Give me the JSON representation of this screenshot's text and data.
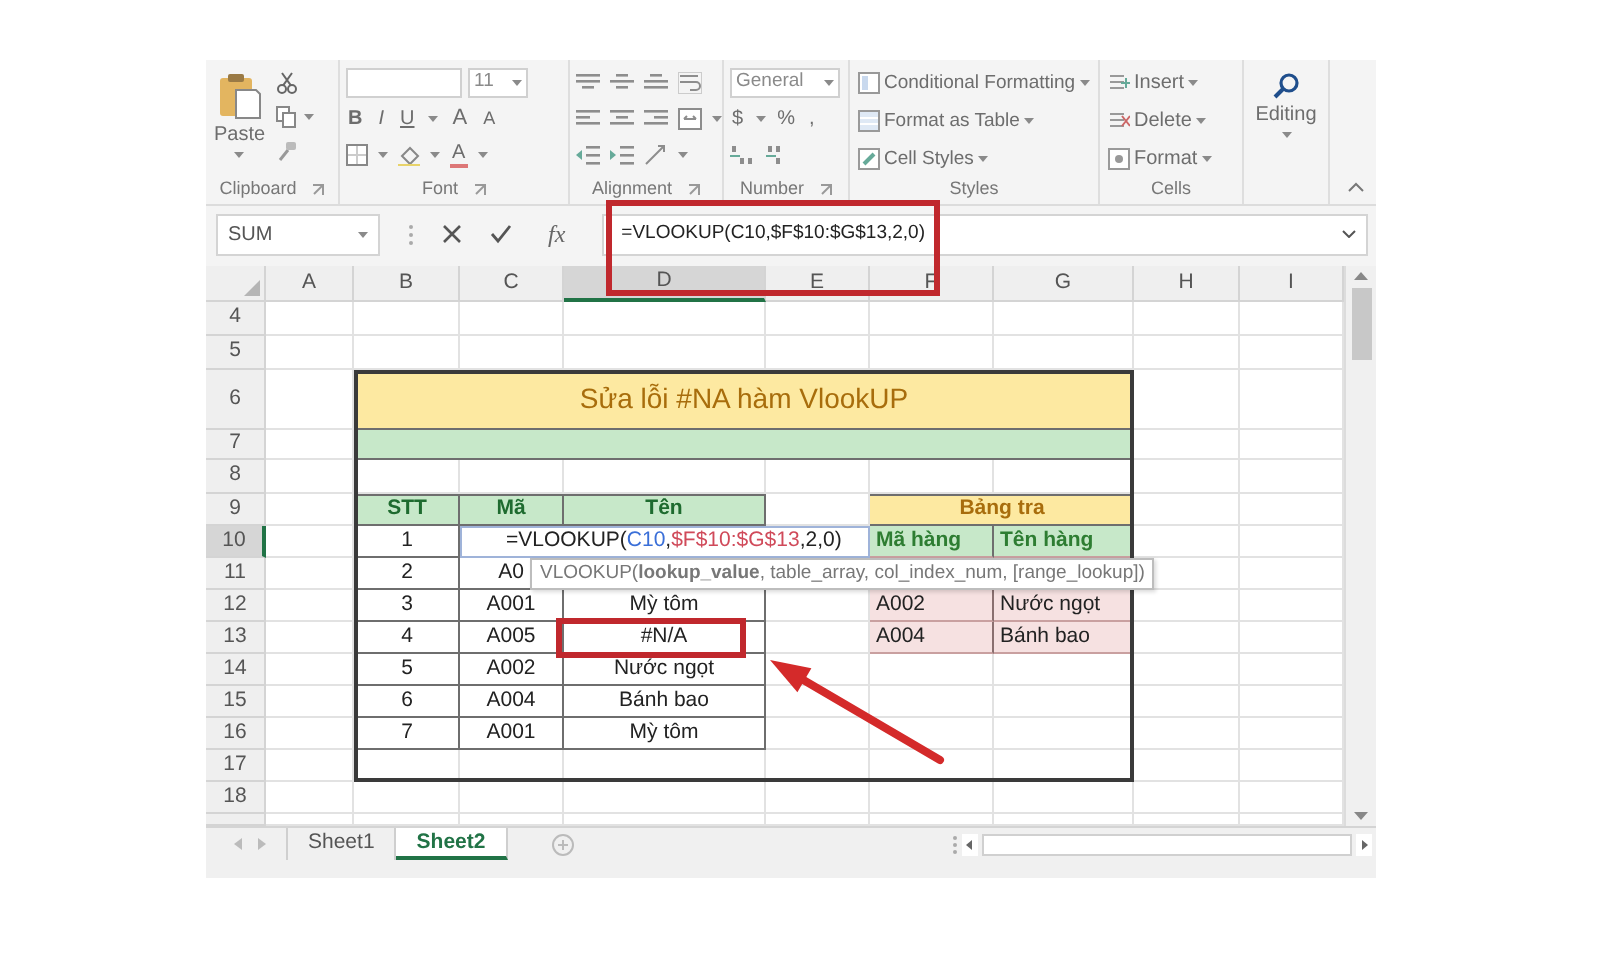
{
  "ribbon": {
    "groups": [
      {
        "kind": "clipboard",
        "label": "Clipboard",
        "paste": "Paste"
      },
      {
        "kind": "font",
        "label": "Font",
        "size": "11",
        "styles": [
          "B",
          "I",
          "U"
        ],
        "grow": "A",
        "shrink": "A",
        "font_color_label": "A"
      },
      {
        "kind": "alignment",
        "label": "Alignment"
      },
      {
        "kind": "number",
        "label": "Number",
        "format": "General",
        "symbols": [
          "$",
          "%",
          ","
        ]
      },
      {
        "kind": "styles",
        "label": "Styles",
        "commands": [
          "Conditional Formatting",
          "Format as Table",
          "Cell Styles"
        ]
      },
      {
        "kind": "cells",
        "label": "Cells",
        "commands": [
          "Insert",
          "Delete",
          "Format"
        ]
      },
      {
        "kind": "editing",
        "command": "Editing"
      }
    ]
  },
  "formula_bar": {
    "name_box": "SUM",
    "function_label": "fx",
    "formula": "=VLOOKUP(C10,$F$10:$G$13,2,0)",
    "flagged": true
  },
  "grid": {
    "columns": [
      {
        "label": "A",
        "selected": false
      },
      {
        "label": "B",
        "selected": false
      },
      {
        "label": "C",
        "selected": false
      },
      {
        "label": "D",
        "selected": true
      },
      {
        "label": "E",
        "selected": false
      },
      {
        "label": "F",
        "selected": false
      },
      {
        "label": "G",
        "selected": false
      },
      {
        "label": "H",
        "selected": false
      },
      {
        "label": "I",
        "selected": false
      }
    ],
    "rows": [
      {
        "label": "4",
        "selected": false
      },
      {
        "label": "5",
        "selected": false
      },
      {
        "label": "6",
        "selected": false
      },
      {
        "label": "7",
        "selected": false
      },
      {
        "label": "8",
        "selected": false
      },
      {
        "label": "9",
        "selected": false
      },
      {
        "label": "10",
        "selected": true
      },
      {
        "label": "11",
        "selected": false
      },
      {
        "label": "12",
        "selected": false
      },
      {
        "label": "13",
        "selected": false
      },
      {
        "label": "14",
        "selected": false
      },
      {
        "label": "15",
        "selected": false
      },
      {
        "label": "16",
        "selected": false
      },
      {
        "label": "17",
        "selected": false
      },
      {
        "label": "18",
        "selected": false
      }
    ]
  },
  "main_table": {
    "title": "Sửa lỗi #NA hàm VlookUP",
    "headers": [
      "STT",
      "Mã",
      "Tên"
    ],
    "rows": [
      {
        "cells": [
          "1"
        ],
        "flagged": false
      },
      {
        "cells": [
          "2",
          "A0"
        ],
        "flagged": false
      },
      {
        "cells": [
          "3",
          "A001",
          "Mỳ tôm"
        ],
        "flagged": false
      },
      {
        "cells": [
          "4",
          "A005",
          "#N/A"
        ],
        "flagged": true
      },
      {
        "cells": [
          "5",
          "A002",
          "Nước ngọt"
        ],
        "flagged": false
      },
      {
        "cells": [
          "6",
          "A004",
          "Bánh bao"
        ],
        "flagged": false
      },
      {
        "cells": [
          "7",
          "A001",
          "Mỳ tôm"
        ],
        "flagged": false
      }
    ]
  },
  "lookup_table": {
    "title": "Bảng tra",
    "headers": [
      "Mã hàng",
      "Tên hàng"
    ],
    "rows": [
      [
        "A002",
        "Nước ngọt"
      ],
      [
        "A004",
        "Bánh bao"
      ]
    ]
  },
  "cell_editor": {
    "parts": [
      {
        "text": "=VLOOKUP(",
        "color": "#222222"
      },
      {
        "text": "C10",
        "color": "#3a6fd8"
      },
      {
        "text": ",",
        "color": "#222222"
      },
      {
        "text": "$F$10:$G$13",
        "color": "#d04a5a"
      },
      {
        "text": ",2,0)",
        "color": "#222222"
      }
    ]
  },
  "tooltip": "VLOOKUP(**lookup_value**, table_array, col_index_num, [range_lookup])",
  "sheet_tabs": [
    {
      "label": "Sheet1",
      "selected": false
    },
    {
      "label": "Sheet2",
      "selected": true
    }
  ]
}
